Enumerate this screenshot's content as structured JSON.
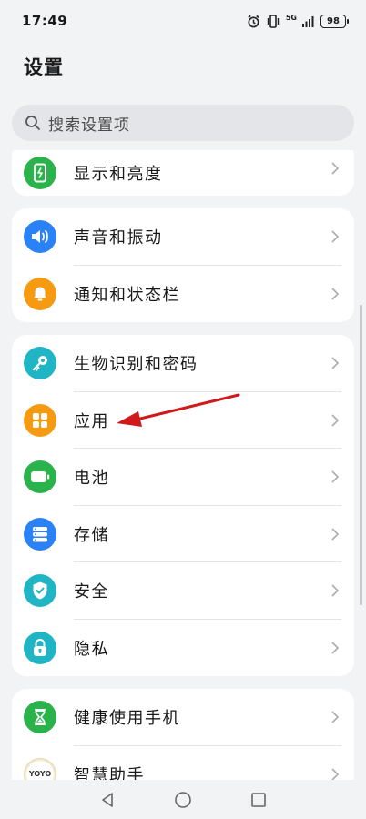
{
  "status_bar": {
    "time": "17:49",
    "network": "5G",
    "battery": "98"
  },
  "header": {
    "title": "设置"
  },
  "search": {
    "placeholder": "搜索设置项"
  },
  "groups": [
    {
      "items": [
        {
          "label": "显示和亮度",
          "icon": "display-brightness-icon",
          "color": "#2ab24b"
        }
      ]
    },
    {
      "items": [
        {
          "label": "声音和振动",
          "icon": "volume-icon",
          "color": "#2a82f6"
        },
        {
          "label": "通知和状态栏",
          "icon": "bell-icon",
          "color": "#f59a11"
        }
      ]
    },
    {
      "items": [
        {
          "label": "生物识别和密码",
          "icon": "key-icon",
          "color": "#1fb5c5"
        },
        {
          "label": "应用",
          "icon": "apps-grid-icon",
          "color": "#f59a11"
        },
        {
          "label": "电池",
          "icon": "battery-icon",
          "color": "#2ab24b"
        },
        {
          "label": "存储",
          "icon": "storage-icon",
          "color": "#2a82f6"
        },
        {
          "label": "安全",
          "icon": "shield-icon",
          "color": "#1fb5c5"
        },
        {
          "label": "隐私",
          "icon": "privacy-lock-icon",
          "color": "#1fb5c5"
        }
      ]
    },
    {
      "items": [
        {
          "label": "健康使用手机",
          "icon": "hourglass-icon",
          "color": "#2ab24b"
        },
        {
          "label": "智慧助手",
          "icon": "yoyo-assistant-icon",
          "color": "#c9a75c",
          "badge_text": "YOYO"
        }
      ]
    }
  ],
  "annotation": {
    "color": "#d0191b"
  },
  "nav": {
    "back": "back-icon",
    "home": "home-icon",
    "recents": "recents-icon"
  }
}
